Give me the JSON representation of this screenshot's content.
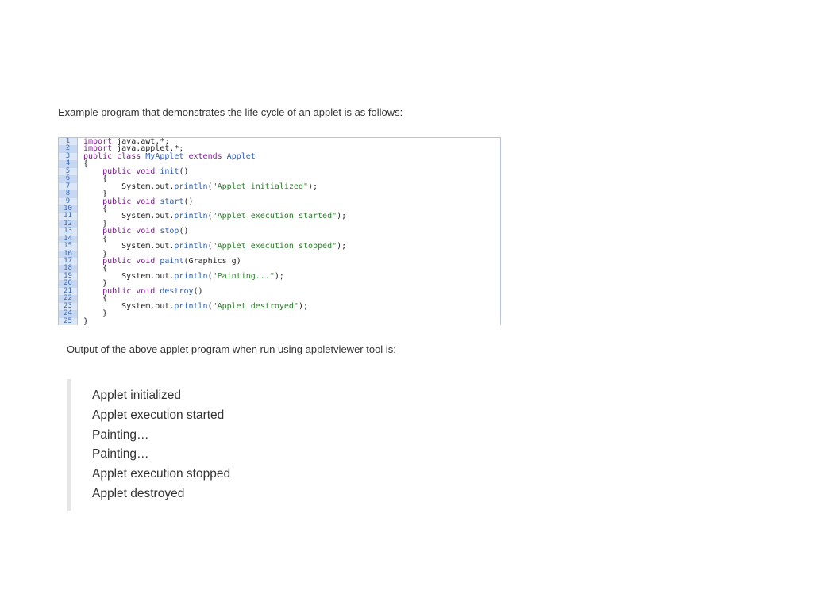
{
  "intro_text": "Example program that demonstrates the life cycle of an applet is as follows:",
  "code": {
    "lines": [
      {
        "num": "1",
        "segments": [
          {
            "t": "kw",
            "s": "import"
          },
          {
            "t": "",
            "s": " java.awt.*;"
          }
        ]
      },
      {
        "num": "2",
        "segments": [
          {
            "t": "kw",
            "s": "import"
          },
          {
            "t": "",
            "s": " java.applet.*;"
          }
        ]
      },
      {
        "num": "3",
        "segments": [
          {
            "t": "kw",
            "s": "public class"
          },
          {
            "t": "",
            "s": " "
          },
          {
            "t": "fn",
            "s": "MyApplet"
          },
          {
            "t": "",
            "s": " "
          },
          {
            "t": "kw",
            "s": "extends"
          },
          {
            "t": "",
            "s": " "
          },
          {
            "t": "fn",
            "s": "Applet"
          }
        ]
      },
      {
        "num": "4",
        "segments": [
          {
            "t": "",
            "s": "{"
          }
        ]
      },
      {
        "num": "5",
        "segments": [
          {
            "t": "",
            "s": "    "
          },
          {
            "t": "kw",
            "s": "public void"
          },
          {
            "t": "",
            "s": " "
          },
          {
            "t": "fn",
            "s": "init"
          },
          {
            "t": "",
            "s": "()"
          }
        ]
      },
      {
        "num": "6",
        "segments": [
          {
            "t": "",
            "s": "    {"
          }
        ]
      },
      {
        "num": "7",
        "segments": [
          {
            "t": "",
            "s": "        System.out."
          },
          {
            "t": "fn",
            "s": "println"
          },
          {
            "t": "",
            "s": "("
          },
          {
            "t": "str",
            "s": "\"Applet initialized\""
          },
          {
            "t": "",
            "s": ");"
          }
        ]
      },
      {
        "num": "8",
        "segments": [
          {
            "t": "",
            "s": "    }"
          }
        ]
      },
      {
        "num": "9",
        "segments": [
          {
            "t": "",
            "s": "    "
          },
          {
            "t": "kw",
            "s": "public void"
          },
          {
            "t": "",
            "s": " "
          },
          {
            "t": "fn",
            "s": "start"
          },
          {
            "t": "",
            "s": "()"
          }
        ]
      },
      {
        "num": "10",
        "segments": [
          {
            "t": "",
            "s": "    {"
          }
        ]
      },
      {
        "num": "11",
        "segments": [
          {
            "t": "",
            "s": "        System.out."
          },
          {
            "t": "fn",
            "s": "println"
          },
          {
            "t": "",
            "s": "("
          },
          {
            "t": "str",
            "s": "\"Applet execution started\""
          },
          {
            "t": "",
            "s": ");"
          }
        ]
      },
      {
        "num": "12",
        "segments": [
          {
            "t": "",
            "s": "    }"
          }
        ]
      },
      {
        "num": "13",
        "segments": [
          {
            "t": "",
            "s": "    "
          },
          {
            "t": "kw",
            "s": "public void"
          },
          {
            "t": "",
            "s": " "
          },
          {
            "t": "fn",
            "s": "stop"
          },
          {
            "t": "",
            "s": "()"
          }
        ]
      },
      {
        "num": "14",
        "segments": [
          {
            "t": "",
            "s": "    {"
          }
        ]
      },
      {
        "num": "15",
        "segments": [
          {
            "t": "",
            "s": "        System.out."
          },
          {
            "t": "fn",
            "s": "println"
          },
          {
            "t": "",
            "s": "("
          },
          {
            "t": "str",
            "s": "\"Applet execution stopped\""
          },
          {
            "t": "",
            "s": ");"
          }
        ]
      },
      {
        "num": "16",
        "segments": [
          {
            "t": "",
            "s": "    }"
          }
        ]
      },
      {
        "num": "17",
        "segments": [
          {
            "t": "",
            "s": "    "
          },
          {
            "t": "kw",
            "s": "public void"
          },
          {
            "t": "",
            "s": " "
          },
          {
            "t": "fn",
            "s": "paint"
          },
          {
            "t": "",
            "s": "(Graphics g)"
          }
        ]
      },
      {
        "num": "18",
        "segments": [
          {
            "t": "",
            "s": "    {"
          }
        ]
      },
      {
        "num": "19",
        "segments": [
          {
            "t": "",
            "s": "        System.out."
          },
          {
            "t": "fn",
            "s": "println"
          },
          {
            "t": "",
            "s": "("
          },
          {
            "t": "str",
            "s": "\"Painting...\""
          },
          {
            "t": "",
            "s": ");"
          }
        ]
      },
      {
        "num": "20",
        "segments": [
          {
            "t": "",
            "s": "    }"
          }
        ]
      },
      {
        "num": "21",
        "segments": [
          {
            "t": "",
            "s": "    "
          },
          {
            "t": "kw",
            "s": "public void"
          },
          {
            "t": "",
            "s": " "
          },
          {
            "t": "fn",
            "s": "destroy"
          },
          {
            "t": "",
            "s": "()"
          }
        ]
      },
      {
        "num": "22",
        "segments": [
          {
            "t": "",
            "s": "    {"
          }
        ]
      },
      {
        "num": "23",
        "segments": [
          {
            "t": "",
            "s": "        System.out."
          },
          {
            "t": "fn",
            "s": "println"
          },
          {
            "t": "",
            "s": "("
          },
          {
            "t": "str",
            "s": "\"Applet destroyed\""
          },
          {
            "t": "",
            "s": ");"
          }
        ]
      },
      {
        "num": "24",
        "segments": [
          {
            "t": "",
            "s": "    }"
          }
        ]
      },
      {
        "num": "25",
        "segments": [
          {
            "t": "",
            "s": "}"
          }
        ]
      }
    ]
  },
  "output_label": "Output of the above applet program when run using appletviewer tool is:",
  "output_lines": [
    "Applet initialized",
    "Applet execution started",
    "Painting…",
    "Painting…",
    "Applet execution stopped",
    "Applet destroyed"
  ],
  "colors": {
    "keyword": "#7a1f8c",
    "identifier": "#2e5fae",
    "string": "#2f7d2f",
    "gutter_bg": "#dbe7f7",
    "output_bar": "#e6e6e6"
  }
}
